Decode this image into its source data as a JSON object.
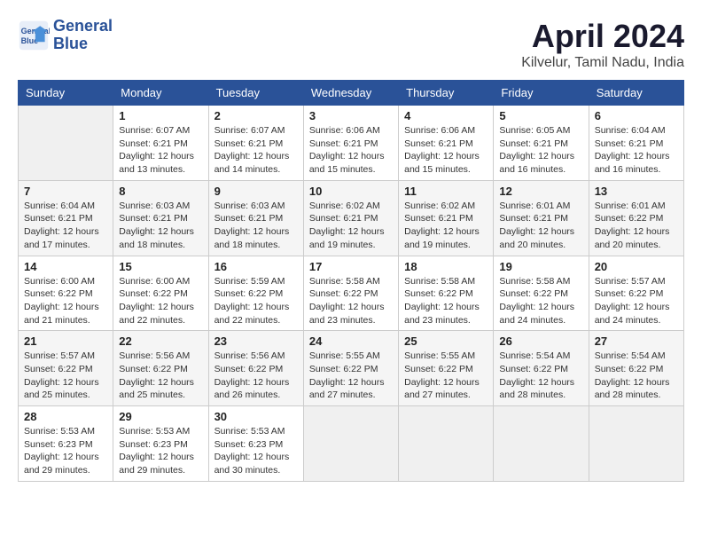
{
  "header": {
    "logo_line1": "General",
    "logo_line2": "Blue",
    "month": "April 2024",
    "location": "Kilvelur, Tamil Nadu, India"
  },
  "days_of_week": [
    "Sunday",
    "Monday",
    "Tuesday",
    "Wednesday",
    "Thursday",
    "Friday",
    "Saturday"
  ],
  "weeks": [
    [
      {
        "day": "",
        "info": ""
      },
      {
        "day": "1",
        "info": "Sunrise: 6:07 AM\nSunset: 6:21 PM\nDaylight: 12 hours\nand 13 minutes."
      },
      {
        "day": "2",
        "info": "Sunrise: 6:07 AM\nSunset: 6:21 PM\nDaylight: 12 hours\nand 14 minutes."
      },
      {
        "day": "3",
        "info": "Sunrise: 6:06 AM\nSunset: 6:21 PM\nDaylight: 12 hours\nand 15 minutes."
      },
      {
        "day": "4",
        "info": "Sunrise: 6:06 AM\nSunset: 6:21 PM\nDaylight: 12 hours\nand 15 minutes."
      },
      {
        "day": "5",
        "info": "Sunrise: 6:05 AM\nSunset: 6:21 PM\nDaylight: 12 hours\nand 16 minutes."
      },
      {
        "day": "6",
        "info": "Sunrise: 6:04 AM\nSunset: 6:21 PM\nDaylight: 12 hours\nand 16 minutes."
      }
    ],
    [
      {
        "day": "7",
        "info": "Sunrise: 6:04 AM\nSunset: 6:21 PM\nDaylight: 12 hours\nand 17 minutes."
      },
      {
        "day": "8",
        "info": "Sunrise: 6:03 AM\nSunset: 6:21 PM\nDaylight: 12 hours\nand 18 minutes."
      },
      {
        "day": "9",
        "info": "Sunrise: 6:03 AM\nSunset: 6:21 PM\nDaylight: 12 hours\nand 18 minutes."
      },
      {
        "day": "10",
        "info": "Sunrise: 6:02 AM\nSunset: 6:21 PM\nDaylight: 12 hours\nand 19 minutes."
      },
      {
        "day": "11",
        "info": "Sunrise: 6:02 AM\nSunset: 6:21 PM\nDaylight: 12 hours\nand 19 minutes."
      },
      {
        "day": "12",
        "info": "Sunrise: 6:01 AM\nSunset: 6:21 PM\nDaylight: 12 hours\nand 20 minutes."
      },
      {
        "day": "13",
        "info": "Sunrise: 6:01 AM\nSunset: 6:22 PM\nDaylight: 12 hours\nand 20 minutes."
      }
    ],
    [
      {
        "day": "14",
        "info": "Sunrise: 6:00 AM\nSunset: 6:22 PM\nDaylight: 12 hours\nand 21 minutes."
      },
      {
        "day": "15",
        "info": "Sunrise: 6:00 AM\nSunset: 6:22 PM\nDaylight: 12 hours\nand 22 minutes."
      },
      {
        "day": "16",
        "info": "Sunrise: 5:59 AM\nSunset: 6:22 PM\nDaylight: 12 hours\nand 22 minutes."
      },
      {
        "day": "17",
        "info": "Sunrise: 5:58 AM\nSunset: 6:22 PM\nDaylight: 12 hours\nand 23 minutes."
      },
      {
        "day": "18",
        "info": "Sunrise: 5:58 AM\nSunset: 6:22 PM\nDaylight: 12 hours\nand 23 minutes."
      },
      {
        "day": "19",
        "info": "Sunrise: 5:58 AM\nSunset: 6:22 PM\nDaylight: 12 hours\nand 24 minutes."
      },
      {
        "day": "20",
        "info": "Sunrise: 5:57 AM\nSunset: 6:22 PM\nDaylight: 12 hours\nand 24 minutes."
      }
    ],
    [
      {
        "day": "21",
        "info": "Sunrise: 5:57 AM\nSunset: 6:22 PM\nDaylight: 12 hours\nand 25 minutes."
      },
      {
        "day": "22",
        "info": "Sunrise: 5:56 AM\nSunset: 6:22 PM\nDaylight: 12 hours\nand 25 minutes."
      },
      {
        "day": "23",
        "info": "Sunrise: 5:56 AM\nSunset: 6:22 PM\nDaylight: 12 hours\nand 26 minutes."
      },
      {
        "day": "24",
        "info": "Sunrise: 5:55 AM\nSunset: 6:22 PM\nDaylight: 12 hours\nand 27 minutes."
      },
      {
        "day": "25",
        "info": "Sunrise: 5:55 AM\nSunset: 6:22 PM\nDaylight: 12 hours\nand 27 minutes."
      },
      {
        "day": "26",
        "info": "Sunrise: 5:54 AM\nSunset: 6:22 PM\nDaylight: 12 hours\nand 28 minutes."
      },
      {
        "day": "27",
        "info": "Sunrise: 5:54 AM\nSunset: 6:22 PM\nDaylight: 12 hours\nand 28 minutes."
      }
    ],
    [
      {
        "day": "28",
        "info": "Sunrise: 5:53 AM\nSunset: 6:23 PM\nDaylight: 12 hours\nand 29 minutes."
      },
      {
        "day": "29",
        "info": "Sunrise: 5:53 AM\nSunset: 6:23 PM\nDaylight: 12 hours\nand 29 minutes."
      },
      {
        "day": "30",
        "info": "Sunrise: 5:53 AM\nSunset: 6:23 PM\nDaylight: 12 hours\nand 30 minutes."
      },
      {
        "day": "",
        "info": ""
      },
      {
        "day": "",
        "info": ""
      },
      {
        "day": "",
        "info": ""
      },
      {
        "day": "",
        "info": ""
      }
    ]
  ]
}
